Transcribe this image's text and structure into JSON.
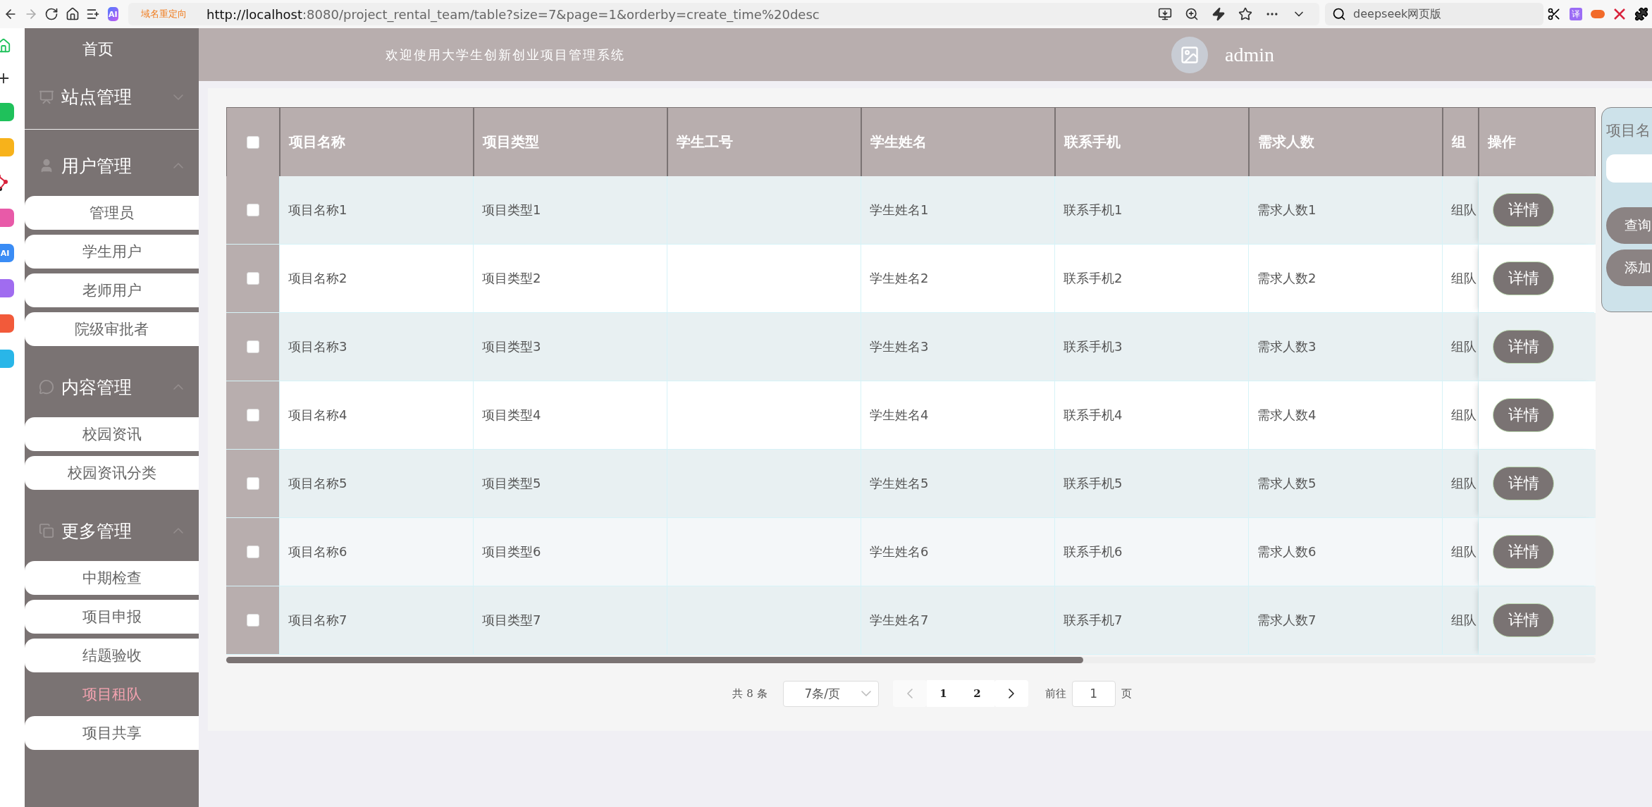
{
  "browser": {
    "ai_badge": "AI",
    "redirect_label": "域名重定向",
    "url_host": "http://localhost",
    "url_rest": ":8080/project_rental_team/table?size=7&page=1&orderby=create_time%20desc",
    "search_value": "deepseek网页版",
    "translate_badge": "译"
  },
  "browser_sidebar": [
    {
      "kind": "home"
    },
    {
      "kind": "plus"
    },
    {
      "kind": "app",
      "color": "#1fc15b"
    },
    {
      "kind": "app",
      "color": "#f7b21b"
    },
    {
      "kind": "dots"
    },
    {
      "kind": "app",
      "color": "#e85aa8"
    },
    {
      "kind": "app",
      "color": "#3a8cf5",
      "label": "AI"
    },
    {
      "kind": "app",
      "color": "#a06cf0"
    },
    {
      "kind": "app",
      "color": "#f25a3a"
    },
    {
      "kind": "app",
      "color": "#29b6e8"
    }
  ],
  "header": {
    "title": "欢迎使用大学生创新创业项目管理系统",
    "user": "admin"
  },
  "sidebar": {
    "home": "首页",
    "groups": [
      {
        "label": "站点管理",
        "kind": "board",
        "expanded": false
      },
      {
        "label": "用户管理",
        "kind": "user",
        "expanded": true,
        "items": [
          {
            "label": "管理员",
            "selected": false
          },
          {
            "label": "学生用户",
            "selected": false
          },
          {
            "label": "老师用户",
            "selected": false
          },
          {
            "label": "院级审批者",
            "selected": false
          }
        ]
      },
      {
        "label": "内容管理",
        "kind": "chat",
        "expanded": true,
        "items": [
          {
            "label": "校园资讯",
            "selected": false
          },
          {
            "label": "校园资讯分类",
            "selected": false
          }
        ]
      },
      {
        "label": "更多管理",
        "kind": "copy",
        "expanded": true,
        "items": [
          {
            "label": "中期检查",
            "selected": false
          },
          {
            "label": "项目申报",
            "selected": false
          },
          {
            "label": "结题验收",
            "selected": false
          },
          {
            "label": "项目租队",
            "selected": true
          },
          {
            "label": "项目共享",
            "selected": false
          }
        ]
      }
    ]
  },
  "table": {
    "all_checked": false,
    "columns": [
      "项目名称",
      "项目类型",
      "学生工号",
      "学生姓名",
      "联系手机",
      "需求人数",
      "组",
      "操作"
    ],
    "rows": [
      {
        "checked": false,
        "cells": [
          "项目名称1",
          "项目类型1",
          "",
          "学生姓名1",
          "联系手机1",
          "需求人数1",
          "组队"
        ],
        "action": "详情"
      },
      {
        "checked": false,
        "cells": [
          "项目名称2",
          "项目类型2",
          "",
          "学生姓名2",
          "联系手机2",
          "需求人数2",
          "组队"
        ],
        "action": "详情"
      },
      {
        "checked": false,
        "cells": [
          "项目名称3",
          "项目类型3",
          "",
          "学生姓名3",
          "联系手机3",
          "需求人数3",
          "组队"
        ],
        "action": "详情"
      },
      {
        "checked": false,
        "cells": [
          "项目名称4",
          "项目类型4",
          "",
          "学生姓名4",
          "联系手机4",
          "需求人数4",
          "组队"
        ],
        "action": "详情"
      },
      {
        "checked": false,
        "cells": [
          "项目名称5",
          "项目类型5",
          "",
          "学生姓名5",
          "联系手机5",
          "需求人数5",
          "组队"
        ],
        "action": "详情"
      },
      {
        "checked": false,
        "cells": [
          "项目名称6",
          "项目类型6",
          "",
          "学生姓名6",
          "联系手机6",
          "需求人数6",
          "组队"
        ],
        "action": "详情"
      },
      {
        "checked": false,
        "cells": [
          "项目名称7",
          "项目类型7",
          "",
          "学生姓名7",
          "联系手机7",
          "需求人数7",
          "组队"
        ],
        "action": "详情"
      }
    ]
  },
  "search_panel": {
    "label": "项目名",
    "buttons": [
      "查询",
      "添加"
    ]
  },
  "pagination": {
    "total": "共 8 条",
    "page_size": "7条/页",
    "prev_disabled": true,
    "pages": [
      "1",
      "2"
    ],
    "goto_label": "前往",
    "goto_value": "1",
    "goto_suffix": "页"
  }
}
